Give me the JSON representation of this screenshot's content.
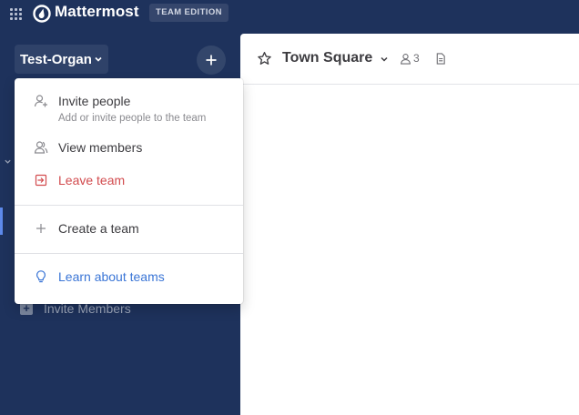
{
  "header": {
    "brand": "Mattermost",
    "edition": "TEAM EDITION"
  },
  "sidebar": {
    "team_name": "Test-Organ",
    "invite_members": "Invite Members"
  },
  "channel": {
    "name": "Town Square",
    "member_count": "3"
  },
  "team_menu": {
    "invite_people": "Invite people",
    "invite_people_sub": "Add or invite people to the team",
    "view_members": "View members",
    "leave_team": "Leave team",
    "create_team": "Create a team",
    "learn_teams": "Learn about teams"
  },
  "colors": {
    "sidebar_bg": "#1e325c",
    "danger": "#d24b4e",
    "link": "#3a75d6"
  }
}
